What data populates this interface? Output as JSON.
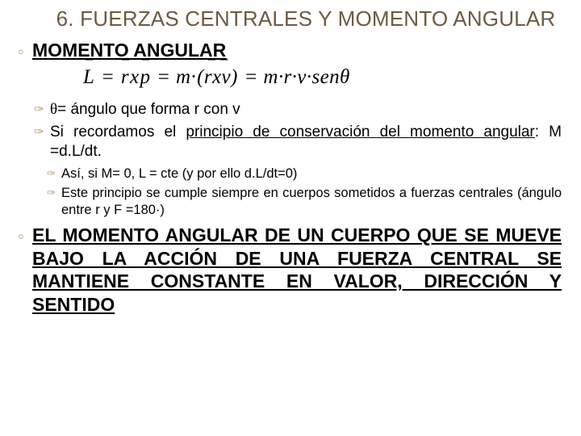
{
  "title": "6. FUERZAS CENTRALES Y MOMENTO ANGULAR",
  "section_heading": "MOMENTO ANGULAR",
  "formula": {
    "L": "L",
    "eq": "=",
    "r": "r",
    "x": "x",
    "p": "p",
    "m": "m",
    "dot": "·",
    "lpar": "(",
    "rpar": ")",
    "v": "v",
    "sen": "sen",
    "theta": "θ"
  },
  "theta_symbol": "θ",
  "bullets": {
    "b1_pre": "= ángulo que forma r con v",
    "b2_a": "Si recordamos el ",
    "b2_u": "principio de conservación del momento angular",
    "b2_b": ": M =d.L/dt.",
    "s1": "Así, si M= 0, L = cte (y por ello d.L/dt=0)",
    "s2": "Este principio se cumple siempre en cuerpos sometidos a fuerzas centrales (ángulo entre r y F =180·)"
  },
  "conclusion": "EL MOMENTO ANGULAR DE UN CUERPO QUE SE MUEVE BAJO LA ACCIÓN DE UNA FUERZA CENTRAL SE MANTIENE CONSTANTE EN VALOR, DIRECCIÓN Y SENTIDO"
}
